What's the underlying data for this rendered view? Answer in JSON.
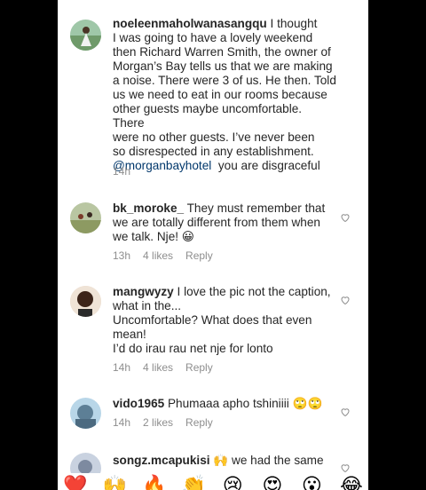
{
  "comments": [
    {
      "username": "noeleenmaholwanasangqu",
      "lines": [
        "I thought",
        "I was going to have a lovely weekend",
        "then Richard Warren Smith, the owner of",
        "Morgan’s Bay tells us that we are making",
        "a noise. There were 3 of us. He then. Told",
        "us we need to eat in our rooms because",
        "other guests maybe uncomfortable. There",
        "were no other guests. I’ve never been",
        "so disrespected in any establishment."
      ],
      "mention": "@morganbayhotel",
      "mention_tail": "you are disgraceful",
      "time": "14h"
    },
    {
      "username": "bk_moroke_",
      "text": "They must remember that we are totally different from them when we talk. Nje! 😀",
      "time": "13h",
      "likes": "4 likes",
      "reply": "Reply"
    },
    {
      "username": "mangwyzy",
      "text": "I love the pic not the caption, what in the...",
      "text2": "Uncomfortable? What does that even mean!",
      "text3": "I’d do irau rau net nje for lonto",
      "time": "14h",
      "likes": "4 likes",
      "reply": "Reply"
    },
    {
      "username": "vido1965",
      "text": "Phumaaa apho tshiniiii 🙄🙄",
      "time": "14h",
      "likes": "2 likes",
      "reply": "Reply"
    },
    {
      "username": "songz.mcapukisi",
      "text": "🙌 we had the same"
    }
  ],
  "emoji_bar": [
    "❤️",
    "🙌",
    "🔥",
    "👏",
    "😢",
    "😍",
    "😮",
    "😂"
  ],
  "colors": {
    "text": "#262626",
    "meta": "#8e8e8e",
    "mention": "#00376b",
    "background": "#ffffff"
  }
}
